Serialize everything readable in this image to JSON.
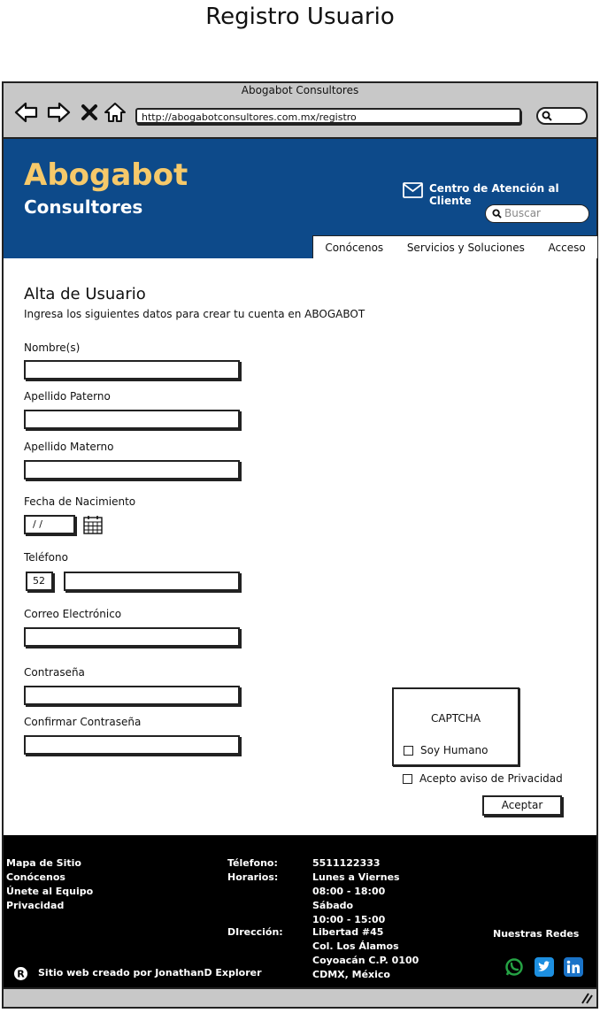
{
  "page_title": "Registro Usuario",
  "browser": {
    "window_title": "Abogabot Consultores",
    "url": "http://abogabotconsultores.com.mx/registro"
  },
  "header": {
    "brand": "Abogabot",
    "brand_sub": "Consultores",
    "support_label": "Centro de Atención al Cliente",
    "search_placeholder": "Buscar",
    "nav": [
      "Conócenos",
      "Servicios y Soluciones",
      "Acceso"
    ]
  },
  "form": {
    "title": "Alta de Usuario",
    "subtitle": "Ingresa los siguientes datos para crear tu cuenta en ABOGABOT",
    "nombre_label": "Nombre(s)",
    "paterno_label": "Apellido Paterno",
    "materno_label": "Apellido Materno",
    "fecha_label": "Fecha de Nacimiento",
    "fecha_value": "/ /",
    "telefono_label": "Teléfono",
    "telefono_code": "52",
    "correo_label": "Correo Electrónico",
    "password_label": "Contraseña",
    "confirm_label": "Confirmar Contraseña",
    "captcha_title": "CAPTCHA",
    "captcha_check": "Soy Humano",
    "privacy_check": "Acepto aviso de Privacidad",
    "submit": "Aceptar"
  },
  "footer": {
    "links": [
      "Mapa de Sitio",
      "Conócenos",
      "Únete al Equipo",
      "Privacidad"
    ],
    "phone_label": "Télefono:",
    "phone_value": "5511122333",
    "hours_label": "Horarios:",
    "hours_lines": [
      "Lunes a Viernes",
      "08:00 - 18:00",
      "Sábado",
      "10:00 - 15:00"
    ],
    "address_label": "DIrección:",
    "address_lines": [
      "Libertad #45",
      "Col. Los Álamos",
      "Coyoacán C.P. 0100",
      "CDMX, México"
    ],
    "social_title": "Nuestras Redes",
    "credit": "Sitio web creado por JonathanD Explorer",
    "registered_symbol": "R"
  },
  "colors": {
    "header_bg": "#0d4a8a",
    "brand": "#f6c96a",
    "whatsapp": "#25a244",
    "twitter": "#1d8fe0",
    "linkedin": "#1a73c8"
  }
}
